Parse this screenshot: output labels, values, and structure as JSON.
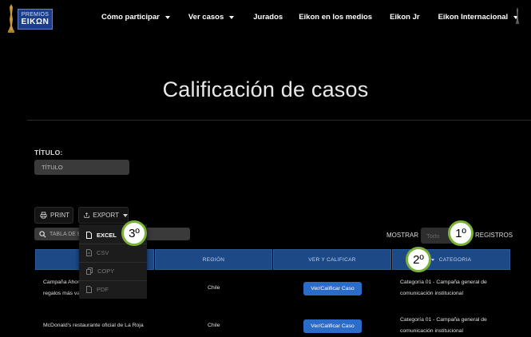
{
  "logo": {
    "line1": "PREMIOS",
    "line2": "EIKΩN"
  },
  "nav": {
    "items": [
      {
        "label": "Cómo participar",
        "dropdown": true
      },
      {
        "label": "Ver casos",
        "dropdown": true
      },
      {
        "label": "Jurados",
        "dropdown": false
      },
      {
        "label": "Eikon en los medios",
        "dropdown": false
      },
      {
        "label": "Eikon Jr",
        "dropdown": false
      },
      {
        "label": "Eikon Internacional",
        "dropdown": true
      }
    ]
  },
  "page": {
    "title": "Calificación de casos"
  },
  "filter": {
    "label": "TÍTULO:",
    "placeholder": "TÍTULO"
  },
  "toolbar": {
    "print_label": "PRINT",
    "export_label": "EXPORT"
  },
  "search": {
    "placeholder": "TABLA DE B"
  },
  "length": {
    "mostrar_label": "MOSTRAR",
    "selected": "Todo",
    "registros_label": "REGISTROS"
  },
  "export_menu": {
    "items": [
      "EXCEL",
      "CSV",
      "COPY",
      "PDF"
    ],
    "active": "EXCEL"
  },
  "table": {
    "headers": [
      "",
      "REGIÓN",
      "VER Y CALIFICAR",
      "CATEGORIA"
    ],
    "rows": [
      {
        "name_line1": "Campaña Ahorr",
        "name_line2": "regalos más val",
        "region": "Chile",
        "action": "Ver/Calificar Caso",
        "cat_line1": "Categoría 01 - Campaña general de",
        "cat_line2": "comunicación institucional"
      },
      {
        "name_line1": "McDonald's restaurante oficial de La Roja",
        "name_line2": "",
        "region": "Chile",
        "action": "Ver/Calificar Caso",
        "cat_line1": "Categoría 01 - Campaña general de",
        "cat_line2": "comunicación institucional"
      }
    ]
  },
  "annotations": {
    "one": "1º",
    "two": "2º",
    "three": "3º"
  },
  "colors": {
    "accent_blue": "#2c6cc9",
    "header_blue": "#1d4a87",
    "badge_ring": "#7bb238"
  }
}
